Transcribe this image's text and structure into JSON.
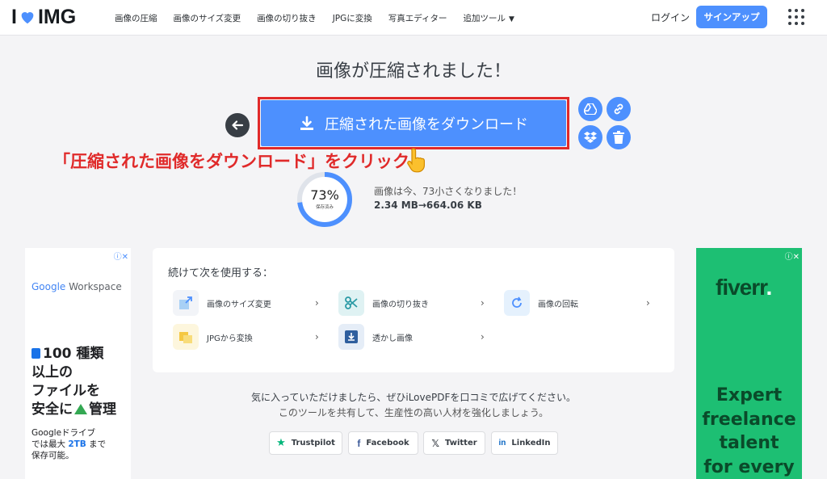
{
  "header": {
    "logo_left": "I",
    "logo_right": "IMG",
    "nav": [
      "画像の圧縮",
      "画像のサイズ変更",
      "画像の切り抜き",
      "JPGに変換",
      "写真エディター",
      "追加ツール"
    ],
    "login": "ログイン",
    "signup": "サインアップ"
  },
  "main": {
    "title": "画像が圧縮されました！",
    "download_label": "圧縮された画像をダウンロード",
    "annotation": "「圧縮された画像をダウンロード」をクリック",
    "percent": "73%",
    "percent_sub": "保存済み",
    "percent_value": 73,
    "result_text": "画像は今、73小さくなりました！",
    "result_size": "2.34 MB→664.06 KB"
  },
  "continue": {
    "title": "続けて次を使用する：",
    "tools": [
      "画像のサイズ変更",
      "画像の切り抜き",
      "画像の回転",
      "JPGから変換",
      "透かし画像"
    ]
  },
  "share": {
    "line1": "気に入っていただけましたら、ぜひiLovePDFを口コミで広げてください。",
    "line2": "このツールを共有して、生産性の高い人材を強化しましょう。",
    "buttons": [
      "Trustpilot",
      "Facebook",
      "Twitter",
      "LinkedIn"
    ]
  },
  "ad_left": {
    "brand_google": "Google",
    "brand_product": " Workspace",
    "headline": [
      "100 種類",
      "以上の",
      "ファイルを",
      "安全に",
      "管理"
    ],
    "body_1": "Googleドライブ",
    "body_2a": "では最大 ",
    "body_2b": "2TB",
    "body_2c": " まで",
    "body_3": "保存可能。"
  },
  "ad_right": {
    "brand": "fiverr",
    "brand_dot": ".",
    "lines": [
      "Expert",
      "freelance",
      "talent",
      "for every"
    ]
  },
  "colors": {
    "accent": "#4d90fe",
    "annotation_red": "#e02a2a",
    "fiverr_green": "#1dbf73",
    "text_dark": "#383e45"
  }
}
